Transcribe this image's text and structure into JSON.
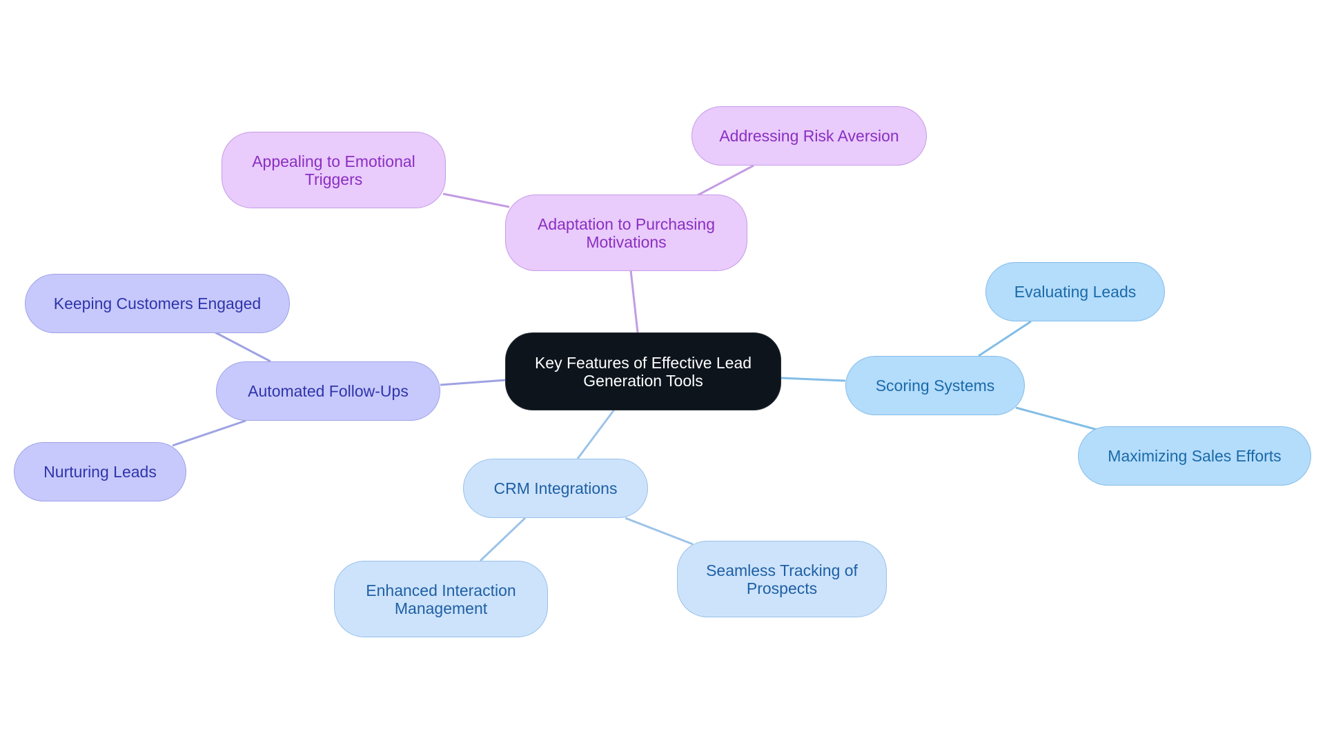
{
  "title": "Key Features of Effective Lead Generation Tools",
  "root": {
    "id": "root",
    "label": "Key Features of Effective Lead Generation Tools"
  },
  "colors": {
    "purple_edge": "#c39be3",
    "indigo_edge": "#9ea2e2",
    "sky_edge": "#82bde6",
    "lightblue_edge": "#9dc3e8"
  },
  "branches": [
    {
      "id": "adaptation",
      "label": "Adaptation to Purchasing Motivations",
      "theme": "purple",
      "children": [
        {
          "id": "appealing",
          "label": "Appealing to Emotional Triggers"
        },
        {
          "id": "addressing",
          "label": "Addressing Risk Aversion"
        }
      ]
    },
    {
      "id": "automated",
      "label": "Automated Follow-Ups",
      "theme": "indigo",
      "children": [
        {
          "id": "keeping",
          "label": "Keeping Customers Engaged"
        },
        {
          "id": "nurturing",
          "label": "Nurturing Leads"
        }
      ]
    },
    {
      "id": "scoring",
      "label": "Scoring Systems",
      "theme": "sky",
      "children": [
        {
          "id": "evaluating",
          "label": "Evaluating Leads"
        },
        {
          "id": "maximizing",
          "label": "Maximizing Sales Efforts"
        }
      ]
    },
    {
      "id": "crm",
      "label": "CRM Integrations",
      "theme": "lightblue",
      "children": [
        {
          "id": "enhanced",
          "label": "Enhanced Interaction Management"
        },
        {
          "id": "seamless",
          "label": "Seamless Tracking of Prospects"
        }
      ]
    }
  ]
}
